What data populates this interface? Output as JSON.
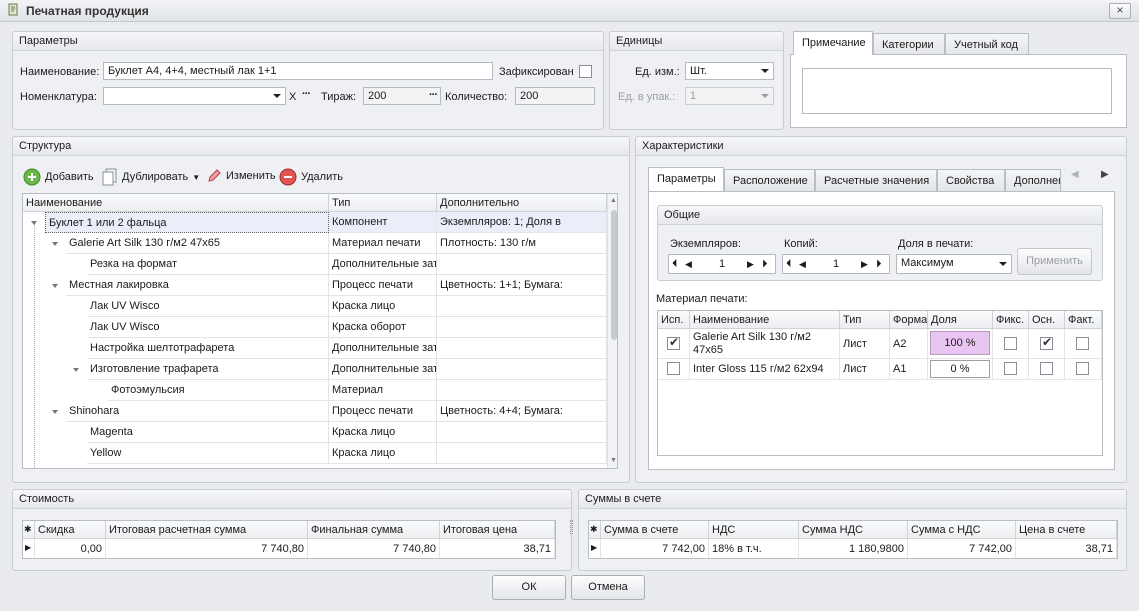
{
  "window": {
    "title": "Печатная продукция",
    "close_label": "×"
  },
  "params": {
    "header": "Параметры",
    "name_label": "Наименование:",
    "name_value": "Буклет А4, 4+4, местный лак 1+1",
    "fixed_label": "Зафиксирован",
    "nomenclature_label": "Номенклатура:",
    "nomenclature_value": "",
    "clear_label": "X",
    "edition_label": "Тираж:",
    "edition_value": "200",
    "quantity_label": "Количество:",
    "quantity_value": "200"
  },
  "units": {
    "header": "Единицы",
    "unit_label": "Ед. изм.:",
    "unit_value": "Шт.",
    "pack_label": "Ед. в упак.:",
    "pack_value": "1"
  },
  "notes_tabs": {
    "tabs": [
      "Примечание",
      "Категории",
      "Учетный код"
    ],
    "note_value": ""
  },
  "structure": {
    "header": "Структура",
    "toolbar": {
      "add": "Добавить",
      "duplicate": "Дублировать",
      "edit": "Изменить",
      "delete": "Удалить"
    },
    "columns": [
      "Наименование",
      "Тип",
      "Дополнительно"
    ],
    "rows": [
      {
        "name": "Буклет 1 или 2 фальца",
        "type": "Компонент",
        "extra": "Экземпляров: 1; Доля в"
      },
      {
        "name": "Galerie Art Silk 130 г/м2 47x65",
        "type": "Материал печати",
        "extra": "Плотность: 130 г/м"
      },
      {
        "name": "Резка на формат",
        "type": "Дополнительные зат",
        "extra": ""
      },
      {
        "name": "Местная лакировка",
        "type": "Процесс печати",
        "extra": "Цветность: 1+1; Бумага:"
      },
      {
        "name": "Лак UV Wisco",
        "type": "Краска лицо",
        "extra": ""
      },
      {
        "name": "Лак UV Wisco",
        "type": "Краска оборот",
        "extra": ""
      },
      {
        "name": "Настройка шелтотрафарета",
        "type": "Дополнительные зат",
        "extra": ""
      },
      {
        "name": "Изготовление трафарета",
        "type": "Дополнительные зат",
        "extra": ""
      },
      {
        "name": "Фотоэмульсия",
        "type": "Материал",
        "extra": ""
      },
      {
        "name": "Shinohara",
        "type": "Процесс печати",
        "extra": "Цветность: 4+4; Бумага:"
      },
      {
        "name": "Magenta",
        "type": "Краска лицо",
        "extra": ""
      },
      {
        "name": "Yellow",
        "type": "Краска лицо",
        "extra": ""
      }
    ]
  },
  "characteristics": {
    "header": "Характеристики",
    "tabs": [
      "Параметры",
      "Расположение",
      "Расчетные значения",
      "Свойства",
      "Дополнен"
    ],
    "general": {
      "header": "Общие",
      "copies_label": "Экземпляров:",
      "copies_value": "1",
      "kopii_label": "Копий:",
      "kopii_value": "1",
      "share_label": "Доля в печати:",
      "share_value": "Максимум",
      "apply_label": "Применить"
    },
    "material_label": "Материал печати:",
    "material_columns": [
      "Исп.",
      "Наименование",
      "Тип",
      "Формат",
      "Доля",
      "Фикс.",
      "Осн.",
      "Факт."
    ],
    "materials": [
      {
        "use": true,
        "name": "Galerie Art Silk 130 г/м2 47x65",
        "type": "Лист",
        "format": "A2",
        "share": "100 %",
        "fixed": false,
        "main": true,
        "fact": false
      },
      {
        "use": false,
        "name": "Inter Gloss  115 г/м2 62x94",
        "type": "Лист",
        "format": "A1",
        "share": "0 %",
        "fixed": false,
        "main": false,
        "fact": false
      }
    ]
  },
  "cost": {
    "header": "Стоимость",
    "columns": [
      "Скидка",
      "Итоговая расчетная сумма",
      "Финальная сумма",
      "Итоговая цена"
    ],
    "values": [
      "0,00",
      "7 740,80",
      "7 740,80",
      "38,71"
    ]
  },
  "invoice": {
    "header": "Суммы в счете",
    "columns": [
      "Сумма в счете",
      "НДС",
      "Сумма НДС",
      "Сумма с НДС",
      "Цена в счете"
    ],
    "values": [
      "7 742,00",
      "18% в т.ч.",
      "1 180,9800",
      "7 742,00",
      "38,71"
    ]
  },
  "footer": {
    "ok": "ОК",
    "cancel": "Отмена"
  },
  "colors": {
    "share_highlight": "#e9c6f2",
    "accent_green": "#55a83a",
    "accent_red": "#d23a3a"
  }
}
